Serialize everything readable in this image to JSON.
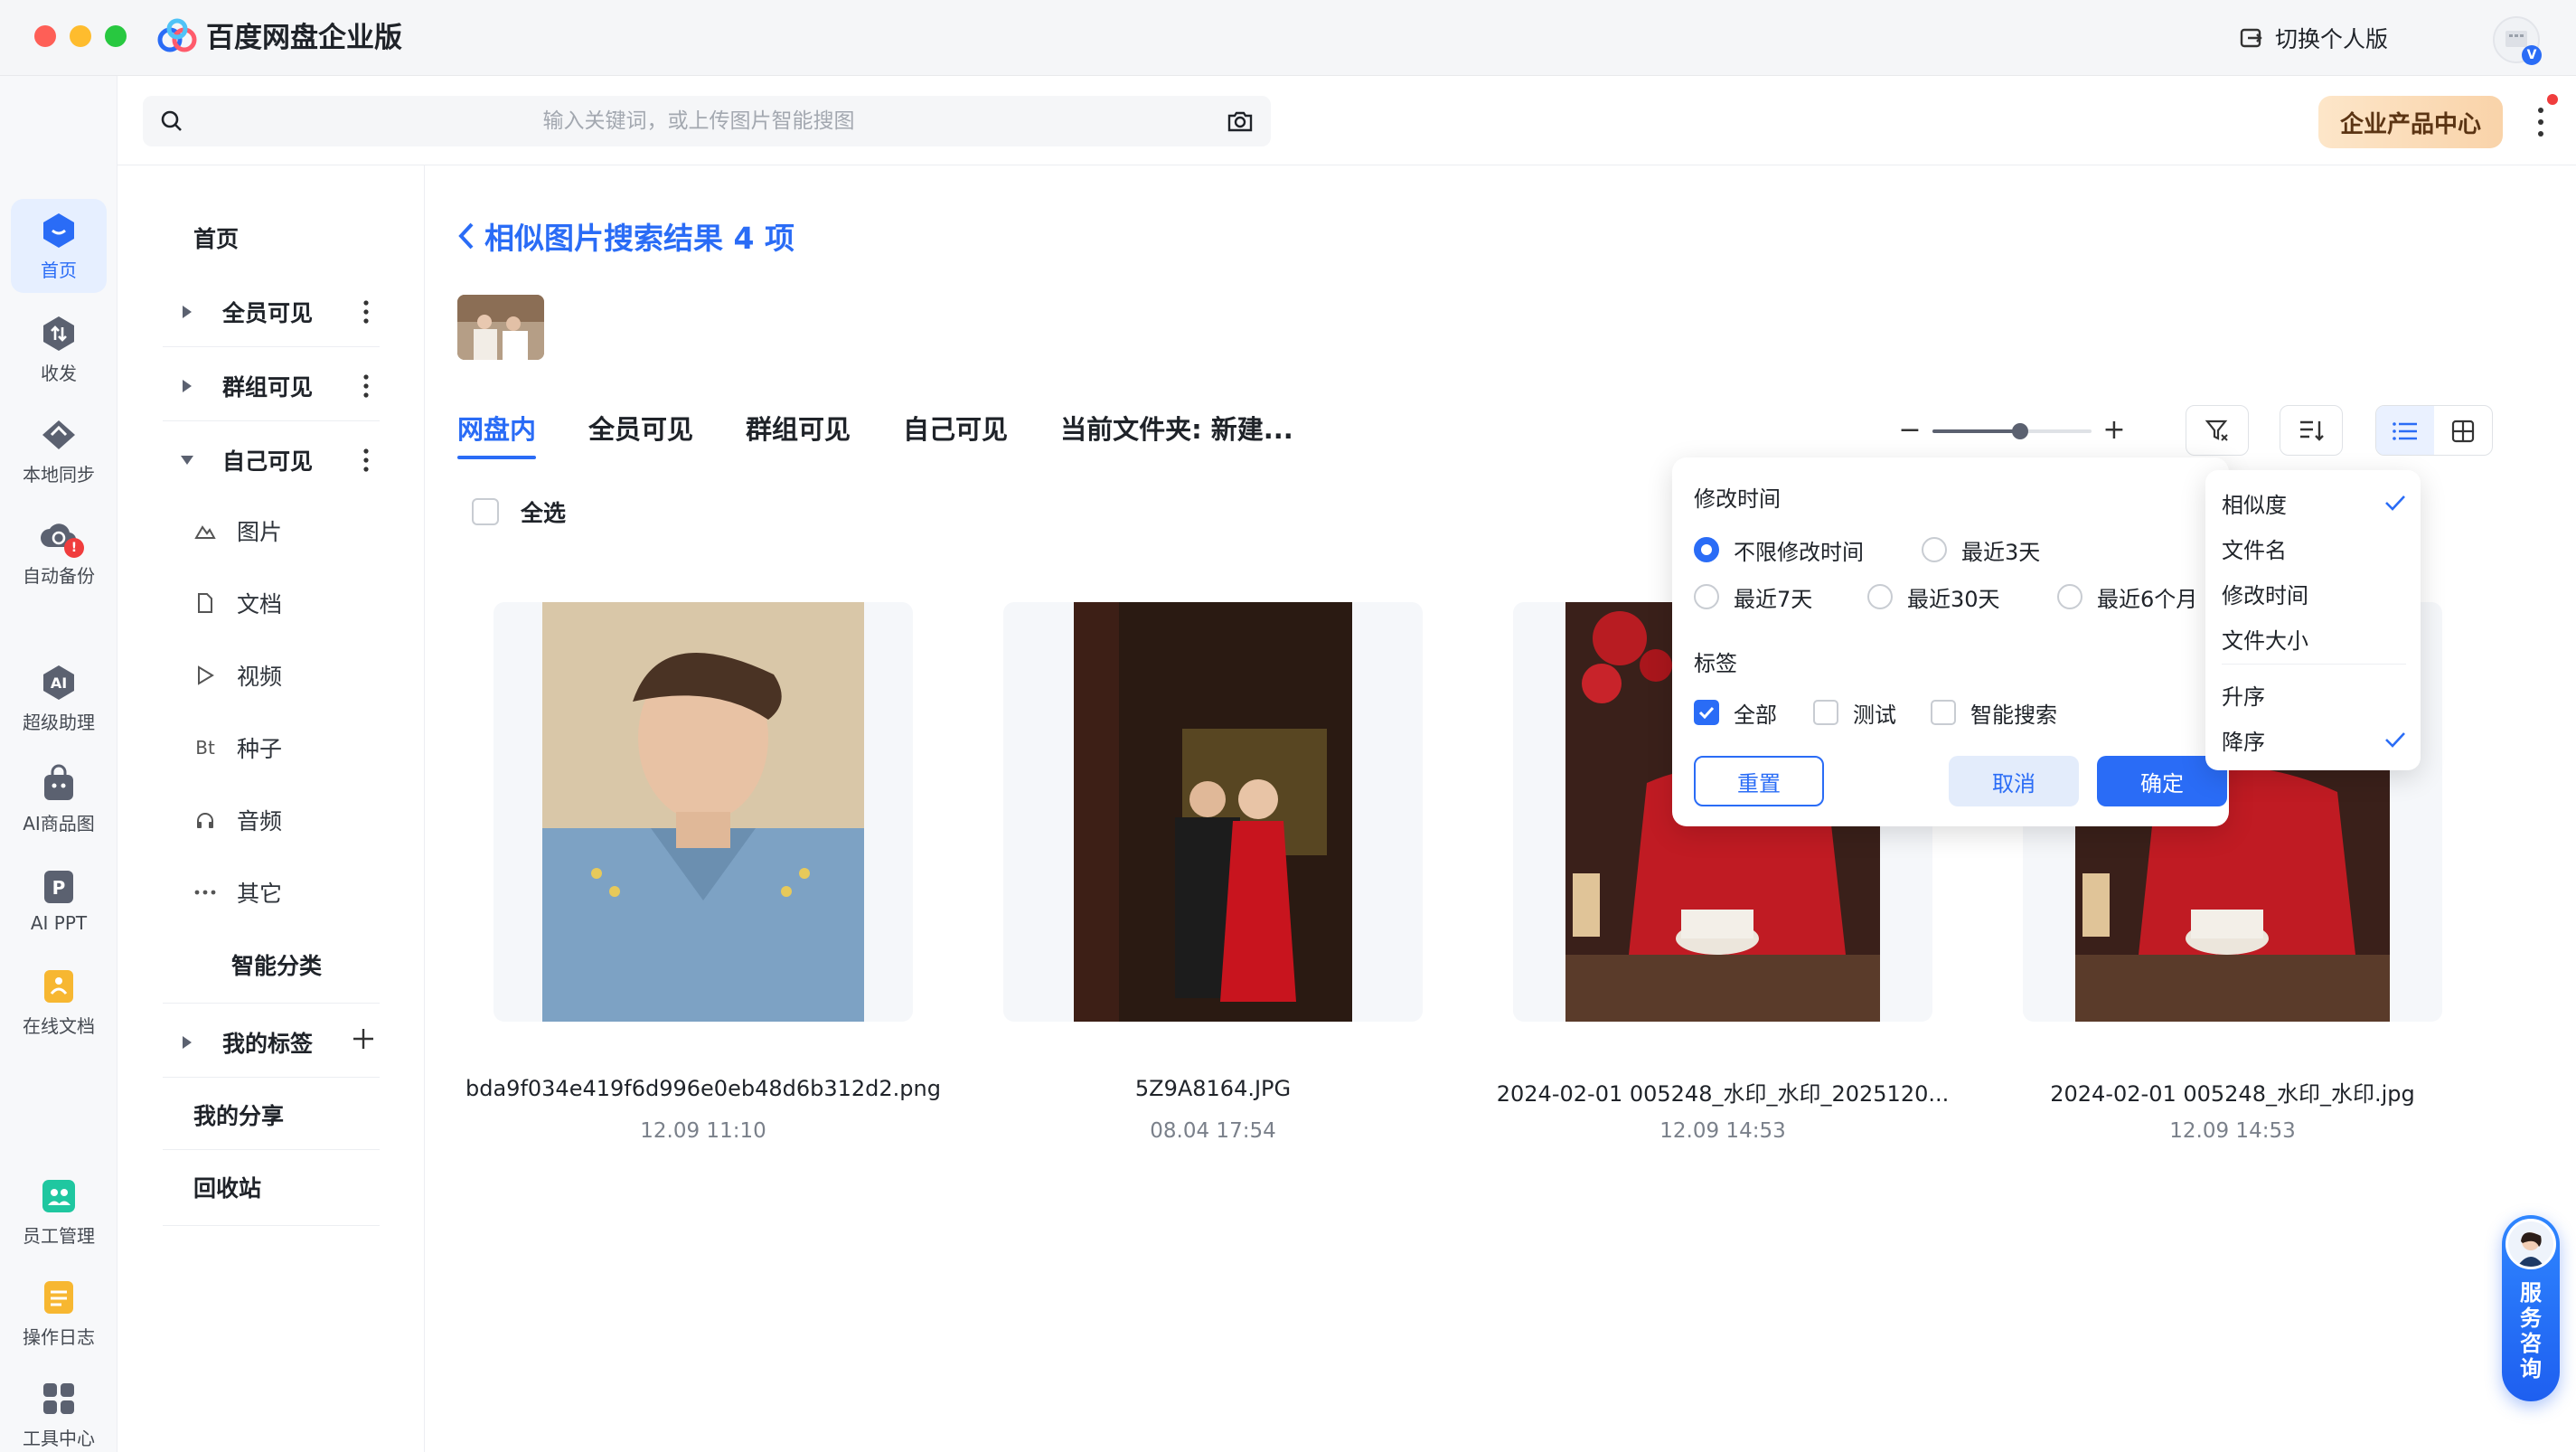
{
  "window": {
    "app_title": "百度网盘企业版",
    "switch_label": "切换个人版"
  },
  "rail": {
    "items": [
      {
        "label": "首页",
        "icon": "home-icon"
      },
      {
        "label": "收发",
        "icon": "transfer-icon"
      },
      {
        "label": "本地同步",
        "icon": "sync-icon"
      },
      {
        "label": "自动备份",
        "icon": "backup-icon",
        "badge": "!"
      },
      {
        "label": "超级助理",
        "icon": "ai-assistant-icon"
      },
      {
        "label": "AI商品图",
        "icon": "ai-product-image-icon"
      },
      {
        "label": "AI PPT",
        "icon": "ai-ppt-icon"
      },
      {
        "label": "在线文档",
        "icon": "online-doc-icon"
      },
      {
        "label": "员工管理",
        "icon": "staff-management-icon"
      },
      {
        "label": "操作日志",
        "icon": "operation-log-icon"
      },
      {
        "label": "工具中心",
        "icon": "tool-center-icon"
      }
    ]
  },
  "search": {
    "placeholder": "输入关键词，或上传图片智能搜图"
  },
  "enterprise_center_label": "企业产品中心",
  "nav": {
    "home": "首页",
    "all_visible": "全员可见",
    "group_visible": "群组可见",
    "self_visible": "自己可见",
    "subs": [
      {
        "label": "图片",
        "icon": "image-icon"
      },
      {
        "label": "文档",
        "icon": "document-icon"
      },
      {
        "label": "视频",
        "icon": "video-icon"
      },
      {
        "label": "种子",
        "icon": "Bt"
      },
      {
        "label": "音频",
        "icon": "audio-icon"
      },
      {
        "label": "其它",
        "icon": "ellipsis-icon"
      }
    ],
    "smart_category": "智能分类",
    "my_tags": "我的标签",
    "my_share": "我的分享",
    "recycle_bin": "回收站"
  },
  "main": {
    "title": "相似图片搜索结果 4 项",
    "tabs": [
      "网盘内",
      "全员可见",
      "群组可见",
      "自己可见",
      "当前文件夹: 新建..."
    ],
    "zoom_level": 0.55,
    "select_all": "全选",
    "files": [
      {
        "name": "bda9f034e419f6d996e0eb48d6b312d2.png",
        "date": "12.09 11:10"
      },
      {
        "name": "5Z9A8164.JPG",
        "date": "08.04 17:54"
      },
      {
        "name": "2024-02-01 005248_水印_水印_2025120...",
        "date": "12.09 14:53"
      },
      {
        "name": "2024-02-01 005248_水印_水印.jpg",
        "date": "12.09 14:53"
      }
    ]
  },
  "filter": {
    "time_title": "修改时间",
    "time_options": [
      "不限修改时间",
      "最近3天",
      "最近7天",
      "最近30天",
      "最近6个月"
    ],
    "time_selected": "不限修改时间",
    "tag_title": "标签",
    "tag_options": [
      "全部",
      "测试",
      "智能搜索"
    ],
    "tag_checked": "全部",
    "reset": "重置",
    "cancel": "取消",
    "confirm": "确定"
  },
  "sort": {
    "fields": [
      "相似度",
      "文件名",
      "修改时间",
      "文件大小"
    ],
    "field_selected": "相似度",
    "orders": [
      "升序",
      "降序"
    ],
    "order_selected": "降序"
  },
  "service": {
    "label": "服务咨询"
  },
  "colors": {
    "accent": "#2a6cf6",
    "enterprise_gradient": "#f9d3a9"
  }
}
